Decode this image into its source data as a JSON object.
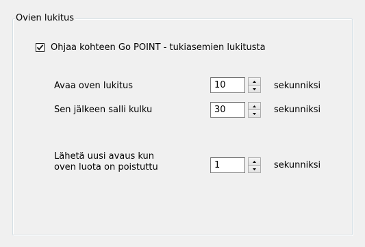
{
  "group": {
    "title": "Ovien lukitus"
  },
  "control_checkbox": {
    "label": "Ohjaa kohteen Go POINT - tukiasemien lukitusta",
    "checked": true
  },
  "rows": [
    {
      "label_line1": "Avaa oven lukitus",
      "label_line2": "",
      "value": "10",
      "unit": "sekunniksi"
    },
    {
      "label_line1": "Sen jälkeen salli kulku",
      "label_line2": "",
      "value": "30",
      "unit": "sekunniksi"
    },
    {
      "label_line1": "Lähetä uusi avaus kun",
      "label_line2": "oven luota on poistuttu",
      "value": "1",
      "unit": "sekunniksi"
    }
  ]
}
